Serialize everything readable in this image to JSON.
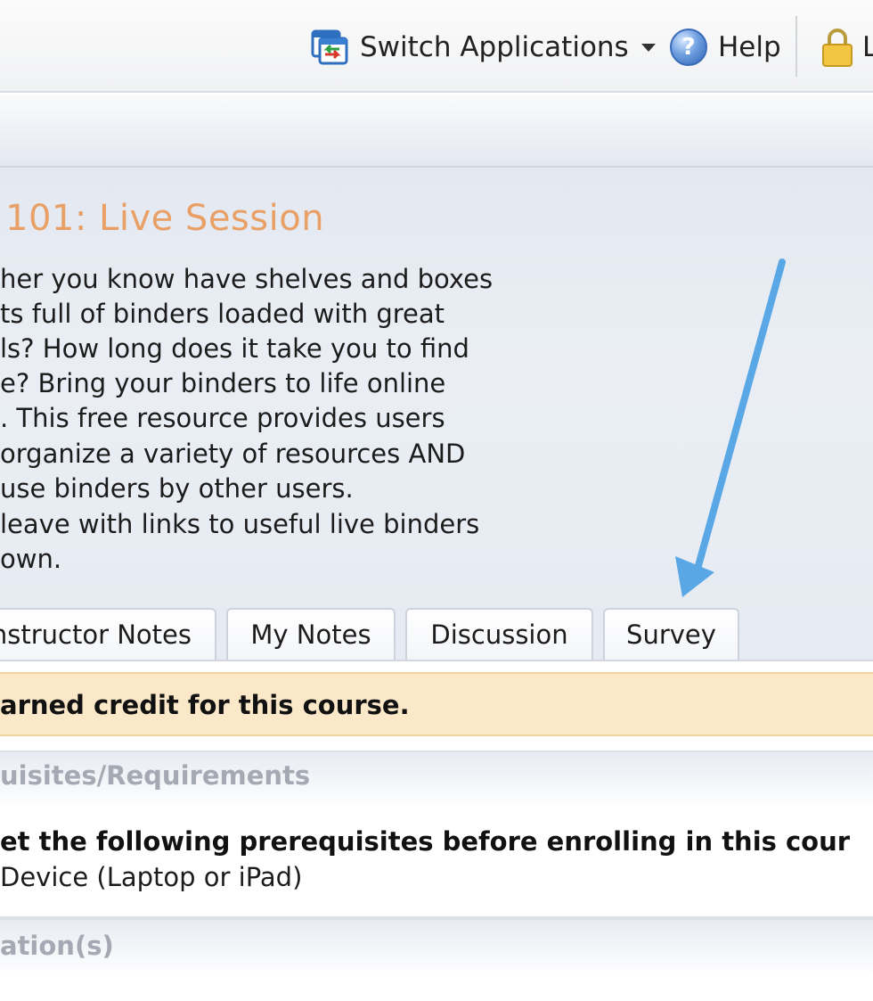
{
  "header": {
    "switch_label": "Switch Applications",
    "help_label": "Help",
    "lock_label_fragment": "L"
  },
  "course": {
    "title": "101: Live Session",
    "description_lines": [
      "her you know have shelves and boxes",
      "ts full of binders loaded with great",
      "ls? How long does it take you to find",
      "e? Bring your binders to life online",
      ". This free resource provides users",
      "organize a variety of resources AND",
      "use binders by other users.",
      "leave with links to useful live binders",
      "own."
    ]
  },
  "tabs": [
    {
      "label": "nstructor Notes"
    },
    {
      "label": "My Notes"
    },
    {
      "label": "Discussion"
    },
    {
      "label": "Survey"
    }
  ],
  "credit_banner": "arned credit for this course.",
  "sections": {
    "prereq_heading": "uisites/Requirements",
    "prereq_intro": "et the following prerequisites before enrolling in this cour",
    "prereq_item": "Device (Laptop or iPad)",
    "next_heading": "ation(s)",
    "trailing_text": "   ·   ·"
  },
  "colors": {
    "title_orange": "#e9a066",
    "arrow_blue": "#5aa7e6",
    "credit_bg": "#fbe8c8",
    "muted_heading": "#a5a9b3"
  }
}
